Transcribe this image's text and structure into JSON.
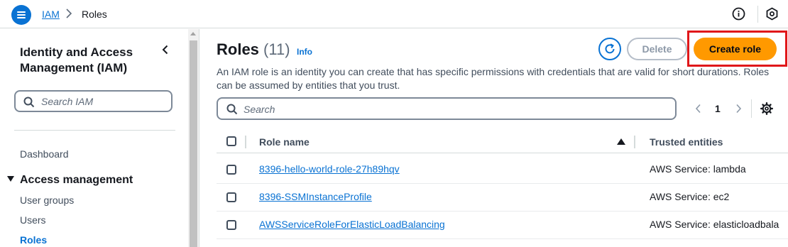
{
  "topbar": {
    "breadcrumb": [
      "IAM",
      "Roles"
    ],
    "icons": [
      "menu-icon",
      "chevron-right-icon",
      "info-icon",
      "hexagon-settings-icon"
    ]
  },
  "sidebar": {
    "title": "Identity and Access Management (IAM)",
    "search_placeholder": "Search IAM",
    "dashboard": "Dashboard",
    "section": "Access management",
    "items": [
      "User groups",
      "Users",
      "Roles"
    ],
    "active_item": "Roles"
  },
  "main": {
    "title": "Roles",
    "count": "(11)",
    "info": "Info",
    "description": "An IAM role is an identity you can create that has specific permissions with credentials that are valid for short durations. Roles can be assumed by entities that you trust.",
    "delete_label": "Delete",
    "create_label": "Create role",
    "search_placeholder": "Search",
    "page": "1"
  },
  "table": {
    "columns": [
      "Role name",
      "Trusted entities"
    ],
    "rows": [
      {
        "name": "8396-hello-world-role-27h89hqv",
        "trusted": "AWS Service: lambda"
      },
      {
        "name": "8396-SSMInstanceProfile",
        "trusted": "AWS Service: ec2"
      },
      {
        "name": "AWSServiceRoleForElasticLoadBalancing",
        "trusted": "AWS Service: elasticloadbala"
      }
    ]
  },
  "colors": {
    "link": "#0972d3",
    "primary_button": "#ff9900",
    "highlight_outline": "#e0171a"
  }
}
